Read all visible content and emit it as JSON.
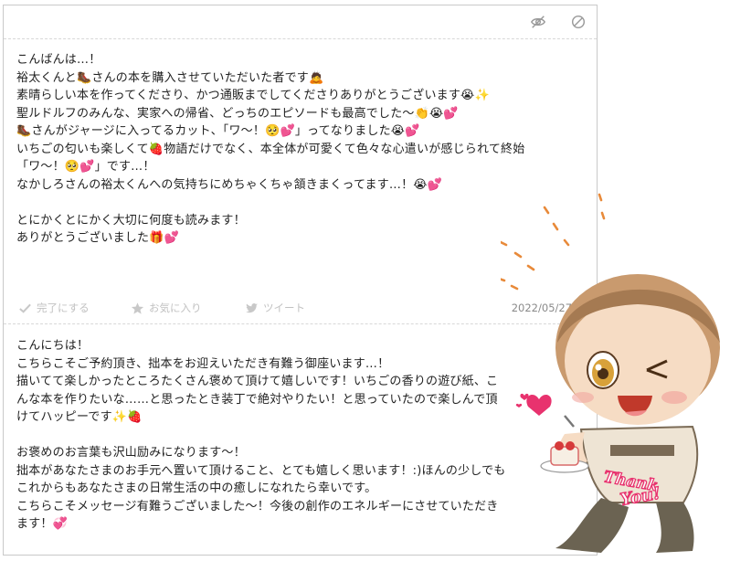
{
  "toolbar": {
    "hide_icon": "eye-slash-icon",
    "block_icon": "prohibit-icon"
  },
  "message": {
    "text": "こんばんは…！\n裕太くんと🥾さんの本を購入させていただいた者です🙇\n素晴らしい本を作ってくださり、かつ通販までしてくださりありがとうございます😭✨\n聖ルドルフのみんな、実家への帰省、どっちのエピソードも最高でした〜👏😭💕\n🥾さんがジャージに入ってるカット、「ワ〜！🥺💕」ってなりました😭💕\nいちごの匂いも楽しくて🍓物語だけでなく、本全体が可愛くて色々な心遣いが感じられて終始\n「ワ〜！🥺💕」です…！\nなかしろさんの裕太くんへの気持ちにめちゃくちゃ頷きまくってます…！😭💕\n\nとにかくとにかく大切に何度も読みます！\nありがとうございました🎁💕"
  },
  "actions": {
    "done": "完了にする",
    "favorite": "お気に入り",
    "tweet": "ツイート",
    "date": "2022/05/27 1"
  },
  "reply": {
    "text": "こんにちは！\nこちらこそご予約頂き、拙本をお迎えいただき有難う御座います…！\n描いてて楽しかったところたくさん褒めて頂けて嬉しいです！いちごの香りの遊び紙、こ\nんな本を作りたいな……と思ったとき装丁で絶対やりたい！と思っていたので楽しんで頂\nけてハッピーです✨🍓\n\nお褒めのお言葉も沢山励みになります〜！\n拙本があなたさまのお手元へ置いて頂けること、とても嬉しく思います！:)ほんの少しでも\nこれからもあなたさまの日常生活の中の癒しになれたら幸いです。\nこちらこそメッセージ有難うございました〜！今後の創作のエネルギーにさせていただき\nます！💞"
  },
  "illustration": {
    "thank_word": "Thank",
    "you_word": "You!",
    "accent": "#e8326e",
    "dash_color": "#e88a3a"
  }
}
